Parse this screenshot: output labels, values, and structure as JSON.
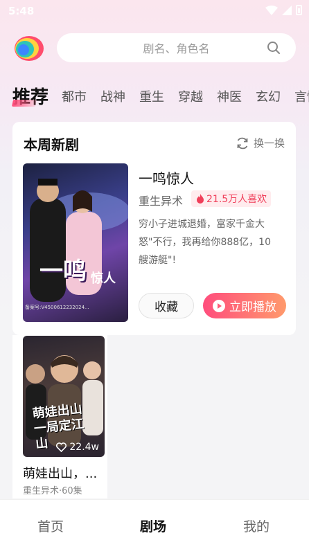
{
  "status_bar": {
    "time": "5:48"
  },
  "search": {
    "placeholder": "剧名、角色名"
  },
  "categories": [
    "推荐",
    "都市",
    "战神",
    "重生",
    "穿越",
    "神医",
    "玄幻",
    "言情"
  ],
  "featured": {
    "section_title": "本周新剧",
    "refresh_label": "换一换",
    "drama": {
      "name": "一鸣惊人",
      "genre": "重生异术",
      "likes": "21.5万人喜欢",
      "description": "穷小子进城退婚，富家千金大怒\"不行，我再给你888亿，10艘游艇\"!",
      "poster_title": "一鸣",
      "poster_sub": "惊人",
      "poster_filing": "备案号:V4500612232024..."
    },
    "collect_label": "收藏",
    "play_label": "立即播放"
  },
  "grid": [
    {
      "name": "萌娃出山，...",
      "poster_title": "萌娃出山 一局定江山",
      "likes": "22.4w",
      "meta": "重生异术·60集"
    }
  ],
  "bottom_nav": {
    "items": [
      "首页",
      "剧场",
      "我的"
    ],
    "active": "剧场"
  },
  "colors": {
    "accent": "#ff4d7d",
    "accent_end": "#ff9a6c",
    "likes_text": "#f03f5a"
  }
}
